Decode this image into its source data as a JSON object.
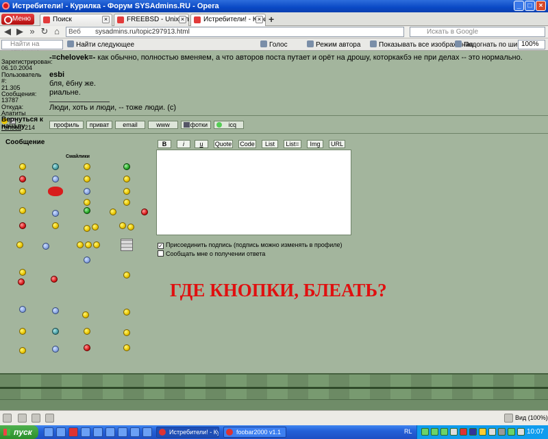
{
  "window": {
    "title": "Истребители! - Курилка - Форум SYSAdmins.RU - Opera"
  },
  "menu": {
    "label": "Меню"
  },
  "tabs": [
    {
      "label": "Поиск"
    },
    {
      "label": "FREEBSD - Unix для нов..."
    },
    {
      "label": "Истребители! - Курилк..."
    }
  ],
  "address": {
    "prefix": "Веб",
    "url": "sysadmins.ru/topic297913.html",
    "search_placeholder": "Искать в Google"
  },
  "findbar": {
    "input_placeholder": "Найти на странице",
    "find_next": "Найти следующее",
    "voice": "Голос",
    "author_mode": "Режим автора",
    "show_images": "Показывать все изображения",
    "fit_width": "Подогнать по ширине",
    "zoom": "100%"
  },
  "post": {
    "side_lines": [
      "Зарегистрирован:",
      "06.10.2004",
      "Пользователь #:",
      "21.305",
      "Сообщения:",
      "13787",
      "Откуда: Апатиты"
    ],
    "votes_label": "Голоса",
    "votes_value": ": 214",
    "quote_line_tag": "-=chelovek=-",
    "quote_line_text": " как обычно, полностью вменяем, а что авторов поста путает и орёт на дрошу, которкакбэ не при делах -- это нормально.",
    "author": "esbi",
    "line2": "бля, ёбну же.",
    "line3": "риальне.",
    "signature": "Люди, хоть и люди, -- тоже люди. (с)"
  },
  "profile_buttons": [
    "профиль",
    "приват",
    "email",
    "www",
    "фотки",
    "icq"
  ],
  "back_to_top": "Вернуться к началу",
  "reply": {
    "message_label": "Сообщение",
    "smiles_title": "Смайлики",
    "toolbar": [
      "B",
      "i",
      "u",
      "Quote",
      "Code",
      "List",
      "List=",
      "Img",
      "URL"
    ],
    "attach_signature": "Присоединить подпись (подпись можно изменять в профиле)",
    "attach_signature_checked": true,
    "notify": "Сообщать мне о получении ответа",
    "notify_checked": false
  },
  "overlay_text": "ГДЕ КНОПКИ, БЛЕАТЬ?",
  "status": {
    "zoom": "Вид (100%)"
  },
  "taskbar": {
    "start": "пуск",
    "tasks": [
      "Истребители! - Кур...",
      "foobar2000 v1.1"
    ],
    "lang": "RL",
    "clock": "10:07"
  }
}
